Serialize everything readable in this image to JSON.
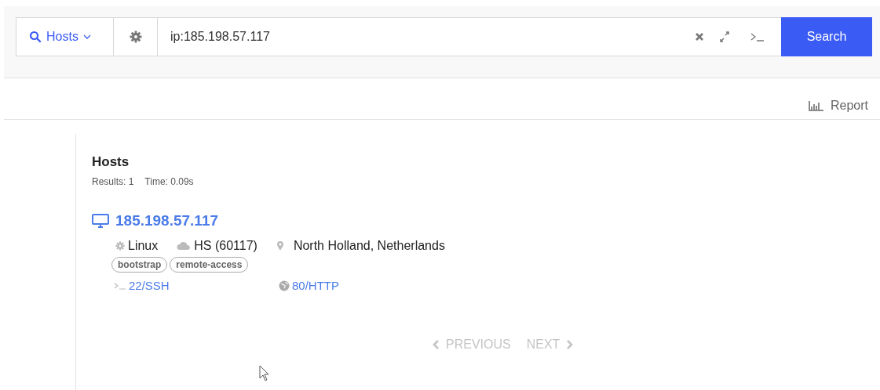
{
  "search_bar": {
    "scope": "Hosts",
    "query": "ip:185.198.57.117",
    "button": "Search"
  },
  "toolbar": {
    "report": "Report"
  },
  "results": {
    "title": "Hosts",
    "count": "Results: 1",
    "time": "Time: 0.09s",
    "hosts": [
      {
        "ip": "185.198.57.117",
        "os": "Linux",
        "network": "HS (60117)",
        "location": "North Holland, Netherlands",
        "tags": [
          "bootstrap",
          "remote-access"
        ],
        "services": [
          {
            "kind": "terminal",
            "label": "22/SSH"
          },
          {
            "kind": "web",
            "label": "80/HTTP"
          }
        ]
      }
    ]
  },
  "pagination": {
    "previous": {
      "label": "PREVIOUS",
      "disabled": true
    },
    "next": {
      "label": "NEXT",
      "disabled": true
    }
  }
}
